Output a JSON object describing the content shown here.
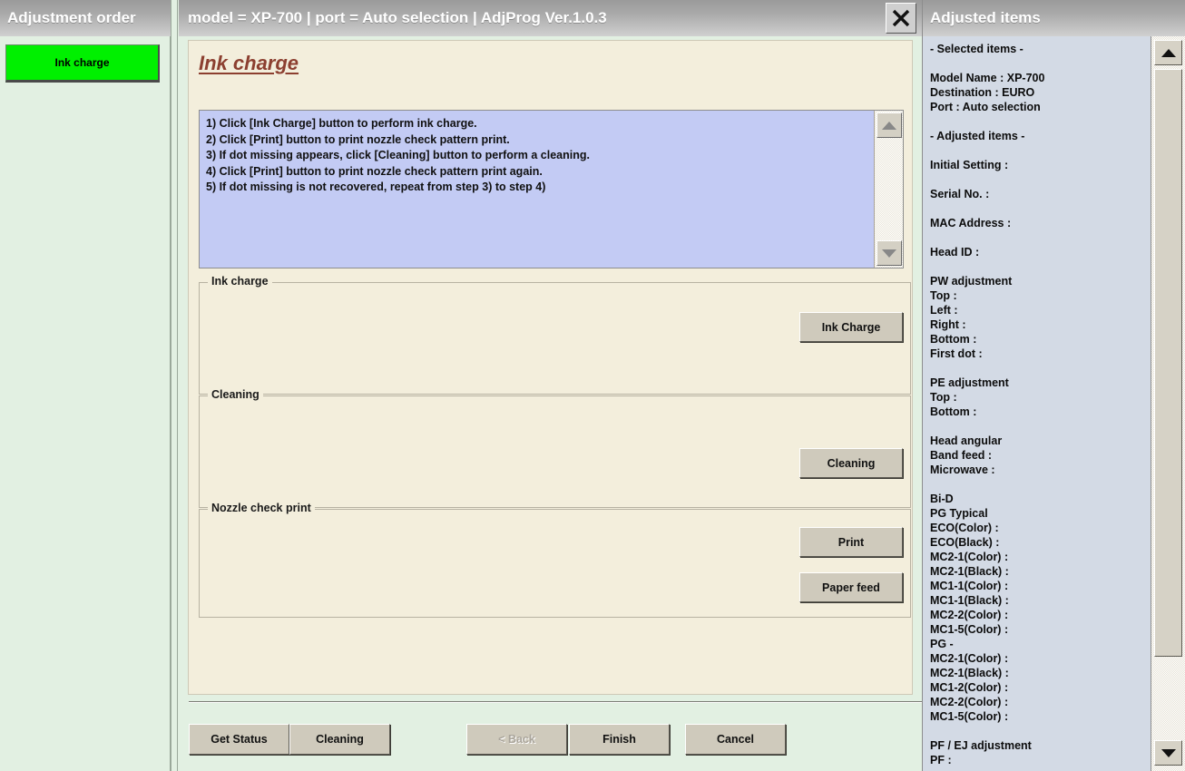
{
  "sidebar": {
    "title": "Adjustment order",
    "items": [
      {
        "label": "Ink charge",
        "state": "selected",
        "color": "#00f000"
      }
    ]
  },
  "center": {
    "titlebar": "model = XP-700  |  port = Auto selection  |  AdjProg Ver.1.0.3",
    "close_label": "close-icon",
    "page_title": "Ink charge",
    "instructions": "1) Click [Ink Charge] button to perform ink charge.\n2) Click [Print] button to print nozzle check pattern print.\n3) If dot missing appears, click [Cleaning] button to perform a cleaning.\n4) Click [Print] button to print nozzle check pattern print again.\n5) If dot missing is not recovered, repeat from step 3) to step 4)",
    "groups": [
      {
        "legend": "Ink charge",
        "button": "Ink Charge"
      },
      {
        "legend": "Cleaning",
        "button": "Cleaning"
      },
      {
        "legend": "Nozzle check print",
        "button_print": "Print",
        "button_feed": "Paper feed"
      }
    ],
    "footer": {
      "get_status": "Get Status",
      "cleaning": "Cleaning",
      "back": "< Back",
      "finish": "Finish",
      "cancel": "Cancel"
    }
  },
  "right": {
    "title": "Adjusted items",
    "body": "- Selected items -\n\nModel Name : XP-700\nDestination : EURO\nPort : Auto selection\n\n- Adjusted items -\n\nInitial Setting :\n\nSerial No. :\n\nMAC Address :\n\nHead ID :\n\nPW adjustment\nTop :\nLeft :\nRight :\nBottom :\nFirst dot :\n\nPE adjustment\nTop :\nBottom :\n\nHead angular\n Band feed :\n Microwave :\n\nBi-D\nPG Typical\n ECO(Color)  :\n ECO(Black)  :\n MC2-1(Color) :\n MC2-1(Black) :\n MC1-1(Color) :\n MC1-1(Black) :\n MC2-2(Color) :\n MC1-5(Color) :\nPG -\n MC2-1(Color) :\n MC2-1(Black) :\n MC1-2(Color) :\n MC2-2(Color) :\n MC1-5(Color) :\n\nPF / EJ adjustment\nPF :"
  },
  "colors": {
    "titlebar_start": "#9a9a9a",
    "titlebar_end": "#d0d0d0",
    "sidebar_bg": "#e2f0e2",
    "content_bg": "#f3eedc",
    "instruction_bg": "#c3cbf4",
    "right_bg": "#d3dae5",
    "selected_item": "#00f000",
    "title_text": "#8c3f30",
    "button_face": "#cfcabc"
  }
}
